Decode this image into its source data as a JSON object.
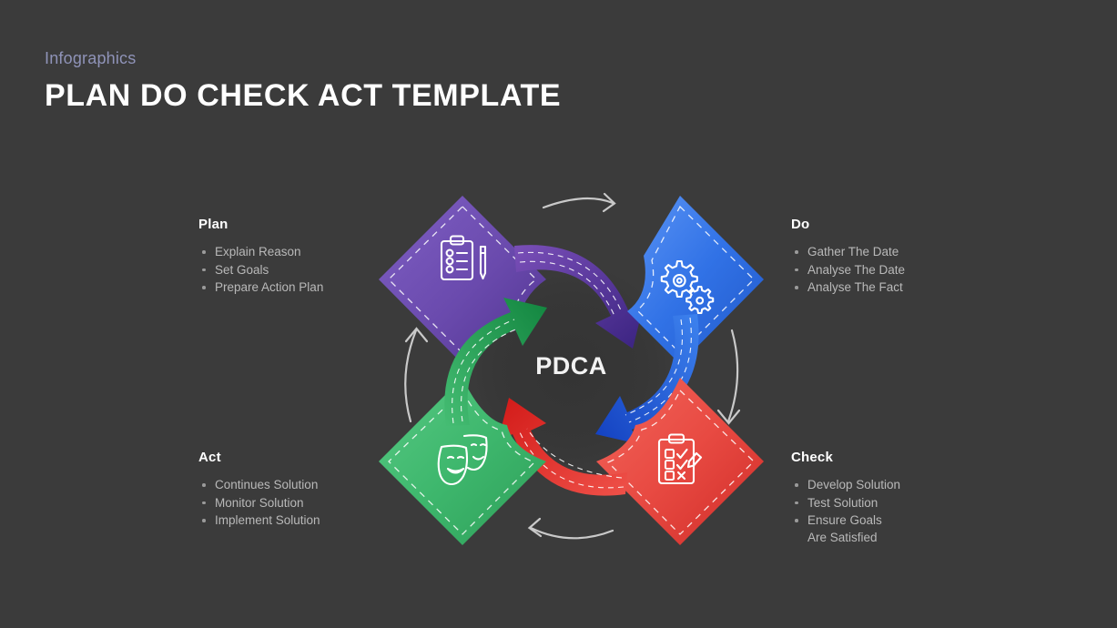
{
  "header": {
    "kicker": "Infographics",
    "title": "PLAN DO CHECK ACT TEMPLATE"
  },
  "diagram": {
    "center_label": "PDCA",
    "background_color": "#3b3b3b",
    "nodes": [
      {
        "key": "plan",
        "label": "Plan",
        "icon": "clipboard-pencil-icon",
        "color": "#6b4aa8",
        "color_light": "#7b5cb8",
        "color_dark": "#4e2f86",
        "position": "top-left"
      },
      {
        "key": "do",
        "label": "Do",
        "icon": "gears-icon",
        "color": "#2f6fe0",
        "color_light": "#4a86ef",
        "color_dark": "#1f56c2",
        "position": "top-right"
      },
      {
        "key": "check",
        "label": "Check",
        "icon": "checklist-pencil-icon",
        "color": "#e53935",
        "color_light": "#f05a52",
        "color_dark": "#cf2b27",
        "position": "bottom-right"
      },
      {
        "key": "act",
        "label": "Act",
        "icon": "theater-masks-icon",
        "color": "#3ab36a",
        "color_light": "#55c57f",
        "color_dark": "#2a9c57",
        "position": "bottom-left"
      }
    ],
    "outer_arrows": [
      {
        "name": "top-arrow",
        "direction": "right"
      },
      {
        "name": "right-arrow",
        "direction": "down"
      },
      {
        "name": "bottom-arrow",
        "direction": "left"
      },
      {
        "name": "left-arrow",
        "direction": "up"
      }
    ]
  },
  "blocks": {
    "plan": {
      "title": "Plan",
      "items": [
        "Explain Reason",
        "Set Goals",
        "Prepare Action Plan"
      ]
    },
    "do": {
      "title": "Do",
      "items": [
        "Gather The Date",
        "Analyse The Date",
        "Analyse The Fact"
      ]
    },
    "act": {
      "title": "Act",
      "items": [
        "Continues Solution",
        "Monitor  Solution",
        "Implement Solution"
      ]
    },
    "check": {
      "title": "Check",
      "items": [
        "Develop Solution",
        "Test Solution",
        "Ensure Goals Are Satisfied"
      ]
    }
  }
}
